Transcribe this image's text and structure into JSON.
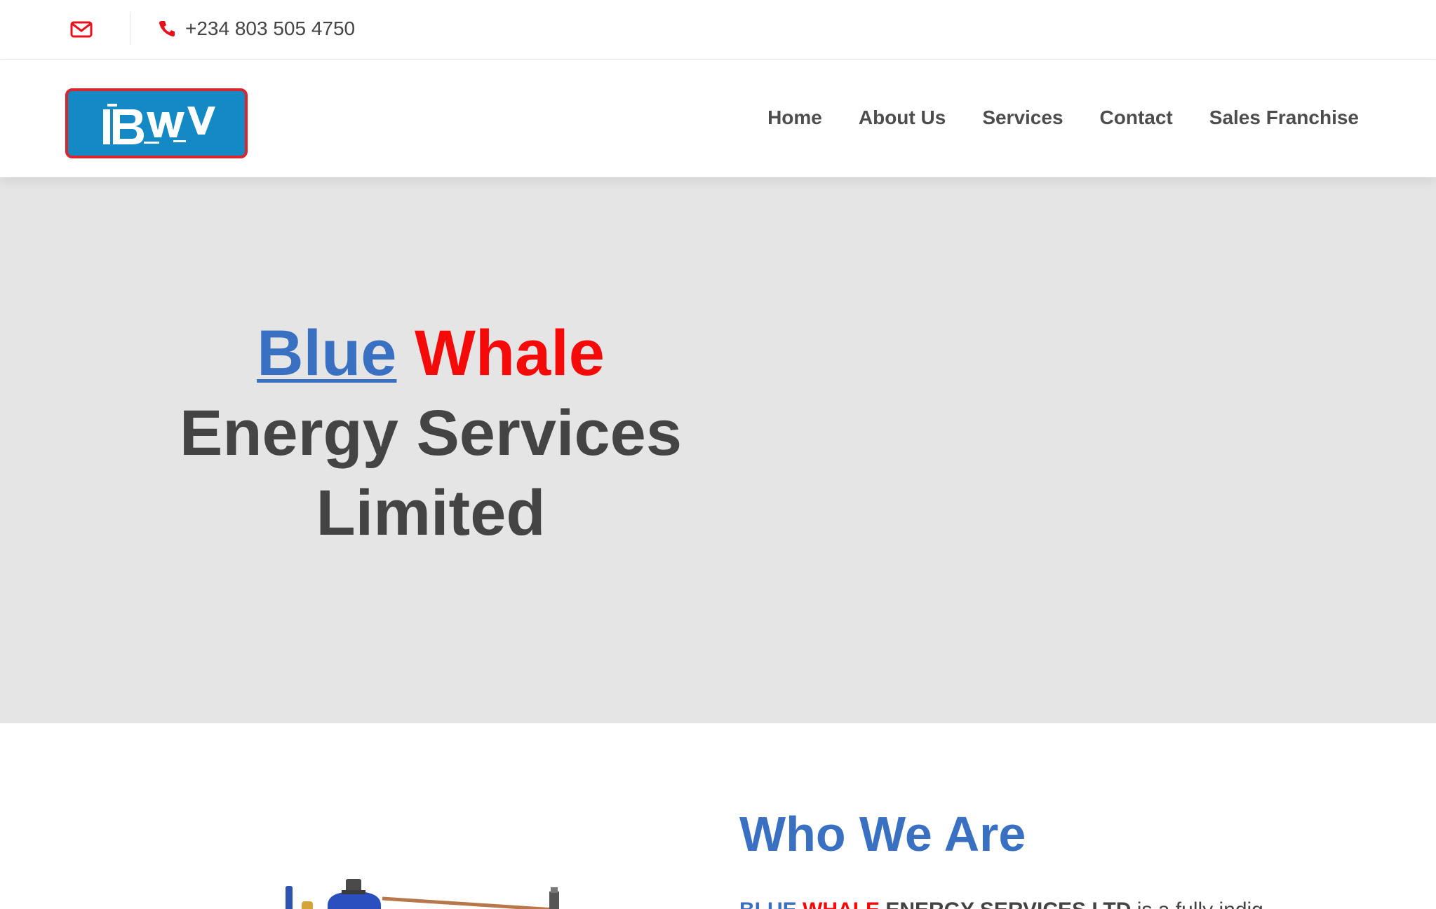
{
  "topbar": {
    "phone": "+234 803 505 4750",
    "icons": [
      "envelope-icon",
      "phone-icon"
    ],
    "accent_color": "#e8101a"
  },
  "header": {
    "logo_text": "BWV",
    "nav": [
      "Home",
      "About Us",
      "Services",
      "Contact",
      "Sales Franchise"
    ]
  },
  "hero": {
    "title_blue": "Blue",
    "title_red": "Whale",
    "title_rest_1": "Energy Services",
    "title_rest_2": "Limited",
    "bg_color": "#e5e5e5"
  },
  "who": {
    "title": "Who We Are",
    "text_blue": "BLUE",
    "text_red": "WHALE",
    "text_dark": "ENERGY SERVICES LTD",
    "text_rest": "is a fully indig"
  },
  "colors": {
    "brand_blue": "#3a70c2",
    "brand_red": "#f50a0a",
    "text_dark": "#444444"
  }
}
